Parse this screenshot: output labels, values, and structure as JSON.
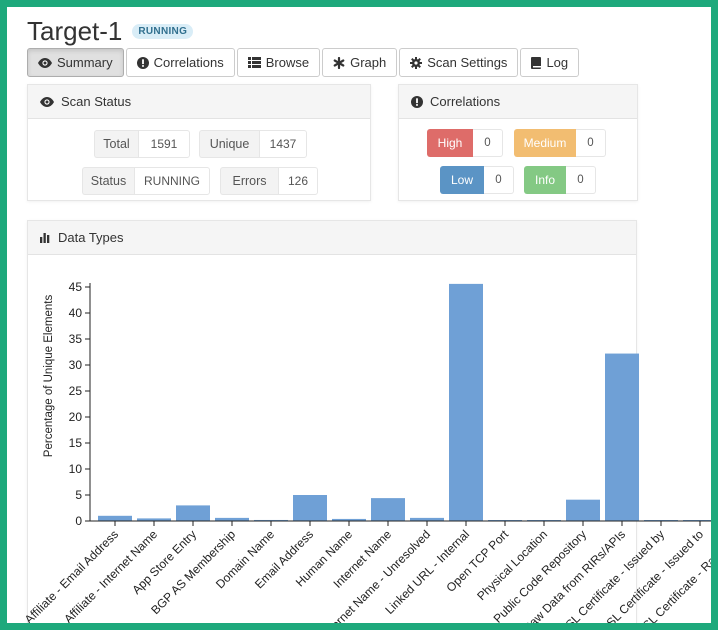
{
  "title": "Target-1",
  "status_badge": "RUNNING",
  "tabs": [
    {
      "label": "Summary",
      "icon": "eye-icon"
    },
    {
      "label": "Correlations",
      "icon": "exclamation-circle-icon"
    },
    {
      "label": "Browse",
      "icon": "list-icon"
    },
    {
      "label": "Graph",
      "icon": "asterisk-icon"
    },
    {
      "label": "Scan Settings",
      "icon": "gear-icon"
    },
    {
      "label": "Log",
      "icon": "book-icon"
    }
  ],
  "scan_status": {
    "title": "Scan Status",
    "total_label": "Total",
    "total_value": "1591",
    "unique_label": "Unique",
    "unique_value": "1437",
    "status_label": "Status",
    "status_value": "RUNNING",
    "errors_label": "Errors",
    "errors_value": "126"
  },
  "correlations": {
    "title": "Correlations",
    "high_label": "High",
    "high_value": "0",
    "medium_label": "Medium",
    "medium_value": "0",
    "low_label": "Low",
    "low_value": "0",
    "info_label": "Info",
    "info_value": "0"
  },
  "colors": {
    "high": "#d9534f",
    "medium": "#f0ad4e",
    "low": "#337ab7",
    "info": "#5cb85c",
    "bar": "#6fa0d6"
  },
  "data_types_title": "Data Types",
  "chart_data": {
    "type": "bar",
    "ylabel": "Percentage of Unique Elements",
    "ylim": [
      0,
      46
    ],
    "yticks": [
      0,
      5,
      10,
      15,
      20,
      25,
      30,
      35,
      40,
      45
    ],
    "categories": [
      "Affiliate - Email Address",
      "Affiliate - Internet Name",
      "App Store Entry",
      "BGP AS Membership",
      "Domain Name",
      "Email Address",
      "Human Name",
      "Internet Name",
      "Internet Name - Unresolved",
      "Linked URL - Internal",
      "Open TCP Port",
      "Physical Location",
      "Public Code Repository",
      "Raw Data from RIRs/APIs",
      "SSL Certificate - Issued by",
      "SSL Certificate - Issued to",
      "SSL Certificate - Raw Data"
    ],
    "values": [
      1.0,
      0.5,
      3.0,
      0.6,
      0.2,
      5.0,
      0.4,
      4.4,
      0.6,
      45.6,
      0.1,
      0.1,
      4.1,
      32.2,
      0.1,
      0.1,
      0.1
    ]
  }
}
